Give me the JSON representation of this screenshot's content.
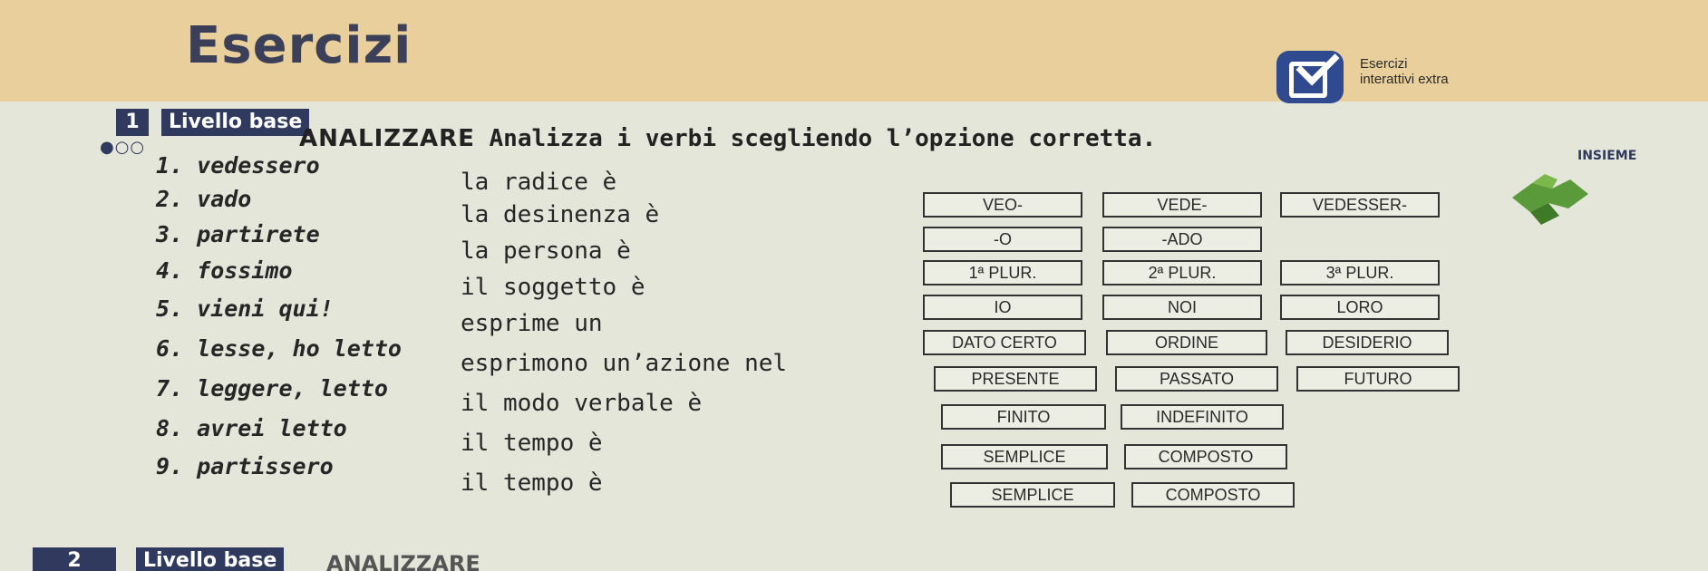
{
  "header": {
    "title": "Esercizi",
    "extra_line1": "Esercizi",
    "extra_line2": "interattivi extra"
  },
  "exercise": {
    "number": "1",
    "level": "Livello base",
    "instruction_caps": "ANALIZZARE",
    "instruction_text": "Analizza i verbi scegliendo l’opzione corretta.",
    "rows": [
      {
        "verb": "1. vedessero",
        "prompt": "la radice è",
        "options": [
          "VEDE-",
          "VEDESSER-"
        ]
      },
      {
        "verb": "2. vado",
        "prompt": "la desinenza è",
        "options": [
          "-O",
          "-ADO"
        ]
      },
      {
        "verb": "3. partirete",
        "prompt": "la persona è",
        "options": [
          "1ª PLUR.",
          "2ª PLUR.",
          "3ª PLUR."
        ]
      },
      {
        "verb": "4. fossimo",
        "prompt": "il soggetto è",
        "options": [
          "IO",
          "NOI",
          "LORO"
        ]
      },
      {
        "verb": "5. vieni qui!",
        "prompt": "esprime un",
        "options": [
          "DATO CERTO",
          "ORDINE",
          "DESIDERIO"
        ]
      },
      {
        "verb": "6. lesse, ho letto",
        "prompt": "esprimono un’azione nel",
        "options": [
          "PRESENTE",
          "PASSATO",
          "FUTURO"
        ]
      },
      {
        "verb": "7. leggere, letto",
        "prompt": "il modo verbale è",
        "options": [
          "FINITO",
          "INDEFINITO"
        ]
      },
      {
        "verb": "8. avrei letto",
        "prompt": "il tempo è",
        "options": [
          "SEMPLICE",
          "COMPOSTO"
        ]
      },
      {
        "verb": "9. partissero",
        "prompt": "il tempo è",
        "options": [
          "SEMPLICE",
          "COMPOSTO"
        ]
      }
    ],
    "first_option_handwritten": "VEO-"
  },
  "corner_label": "INSIEME",
  "next_exercise": {
    "number": "2",
    "level": "Livello base",
    "rest": "ANALIZZARE"
  }
}
